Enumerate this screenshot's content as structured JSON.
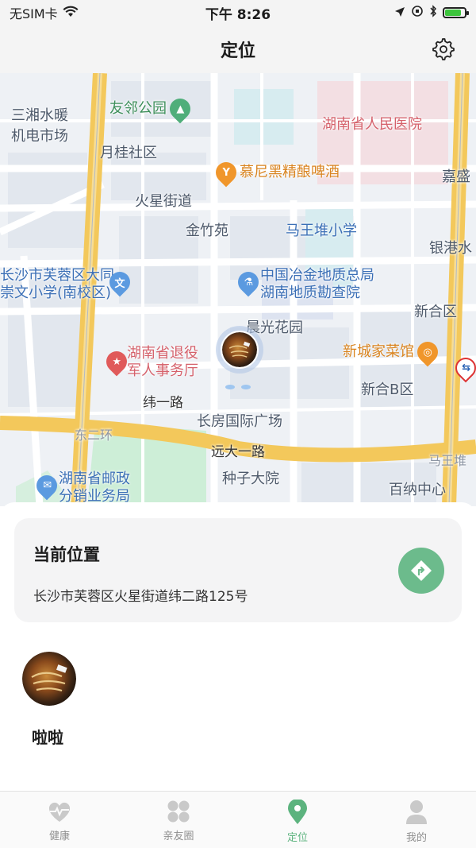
{
  "status_bar": {
    "carrier": "无SIM卡",
    "time": "下午 8:26",
    "battery_color": "#3cc43c"
  },
  "header": {
    "title": "定位",
    "settings_icon": "gear-icon"
  },
  "map": {
    "labels": {
      "sanxiang": "三湘水暖",
      "jidian": "机电市场",
      "youlin_park": "友邻公园",
      "provincial_hospital": "湖南省人民医院",
      "yuegui": "月桂社区",
      "muni_beer": "慕尼黑精酿啤酒",
      "jiasheng": "嘉盛",
      "huoxing_street": "火星街道",
      "jinzhuyuan": "金竹苑",
      "mawangdui_school": "马王堆小学",
      "yingang": "银港水",
      "datong_line1": "长沙市芙蓉区大同",
      "datong_line2": "崇文小学(南校区)",
      "metallurgy_line1": "中国冶金地质总局",
      "metallurgy_line2": "湖南地质勘查院",
      "xinhe": "新合区",
      "chenguang": "晨光花园",
      "xincheng_restaurant": "新城家菜馆",
      "veterans_line1": "湖南省退役",
      "veterans_line2": "军人事务厅",
      "xinhe_b": "新合B区",
      "wei_yi_road": "纬一路",
      "changfang": "长房国际广场",
      "dong_er_huan": "东二环",
      "yuanda_road": "远大一路",
      "mawangdui": "马王堆",
      "postal_line1": "湖南省邮政",
      "postal_line2": "分销业务局",
      "zhongzi": "种子大院",
      "baina": "百纳中心"
    }
  },
  "location_card": {
    "title": "当前位置",
    "address": "长沙市芙蓉区火星街道纬二路125号",
    "accent_color": "#6cbb8c"
  },
  "friends": [
    {
      "name": "啦啦"
    }
  ],
  "tabs": [
    {
      "label": "健康",
      "icon": "heart-pulse-icon"
    },
    {
      "label": "亲友圈",
      "icon": "grid-circles-icon"
    },
    {
      "label": "定位",
      "icon": "location-pin-icon",
      "active": true
    },
    {
      "label": "我的",
      "icon": "person-icon"
    }
  ],
  "active_color": "#5cb37e"
}
